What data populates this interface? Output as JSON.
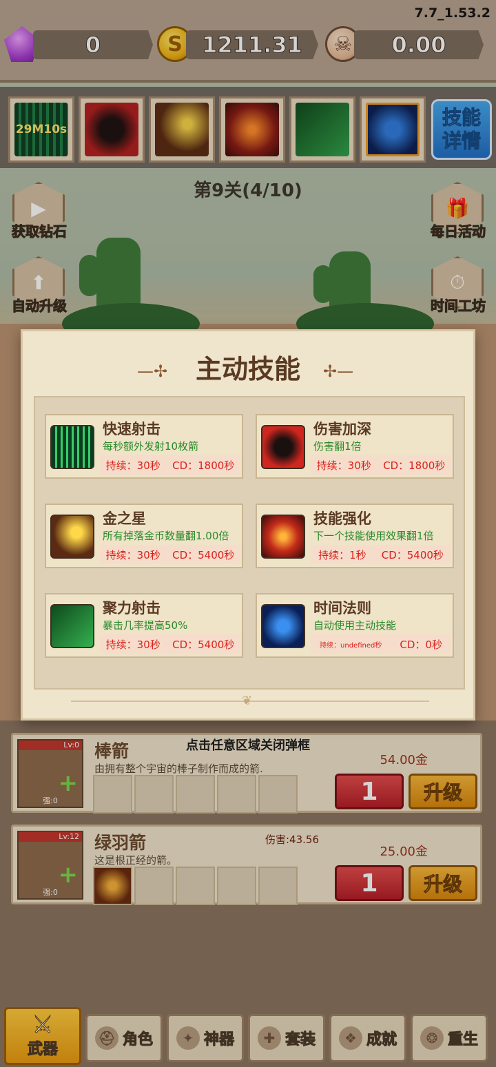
{
  "version": "7.7_1.53.2",
  "resources": {
    "gems": "0",
    "gold": "1211.31",
    "skulls": "0.00",
    "coin_symbol": "S"
  },
  "skill_bar": {
    "first_slot_timer": "29M10s",
    "detail_button": "技能详情"
  },
  "level_text": "第9关(4/10)",
  "side_buttons": {
    "get_diamonds": "获取钻石",
    "auto_upgrade": "自动升级",
    "daily_events": "每日活动",
    "time_workshop": "时间工坊"
  },
  "modal": {
    "title": "主动技能",
    "skills": [
      {
        "name": "快速射击",
        "desc": "每秒额外发射10枚箭",
        "duration": "持续：30秒",
        "cd": "CD：1800秒",
        "icon": "arrow-rain-icon"
      },
      {
        "name": "伤害加深",
        "desc": "伤害翻1倍",
        "duration": "持续：30秒",
        "cd": "CD：1800秒",
        "icon": "dark-warrior-icon"
      },
      {
        "name": "金之星",
        "desc": "所有掉落金币数量翻1.00倍",
        "duration": "持续：30秒",
        "cd": "CD：5400秒",
        "icon": "gold-stars-icon"
      },
      {
        "name": "技能强化",
        "desc": "下一个技能使用效果翻1倍",
        "duration": "持续：1秒",
        "cd": "CD：5400秒",
        "icon": "power-up-icon"
      },
      {
        "name": "聚力射击",
        "desc": "暴击几率提高50%",
        "duration": "持续：30秒",
        "cd": "CD：5400秒",
        "icon": "green-bow-icon"
      },
      {
        "name": "时间法则",
        "desc": "自动使用主动技能",
        "duration": "持续：undefined秒",
        "cd": "CD：0秒",
        "icon": "time-clock-icon"
      }
    ]
  },
  "close_hint": "点击任意区域关闭弹框",
  "weapons": [
    {
      "name": "棒箭",
      "desc": "由拥有整个宇宙的棒子制作而成的箭.",
      "lv": "Lv:0",
      "strength": "强:0",
      "price": "54.00金",
      "qty": "1",
      "upgrade": "升级",
      "damage": ""
    },
    {
      "name": "绿羽箭",
      "desc": "这是根正经的箭。",
      "lv": "Lv:12",
      "strength": "强:0",
      "price": "25.00金",
      "qty": "1",
      "upgrade": "升级",
      "damage": "伤害:43.56"
    }
  ],
  "tabs": [
    {
      "label": "武器",
      "icon": "crossed-swords-icon",
      "active": true
    },
    {
      "label": "角色",
      "icon": "helmet-icon",
      "active": false
    },
    {
      "label": "神器",
      "icon": "artifact-icon",
      "active": false
    },
    {
      "label": "套装",
      "icon": "armor-icon",
      "active": false
    },
    {
      "label": "成就",
      "icon": "achievement-icon",
      "active": false
    },
    {
      "label": "重生",
      "icon": "rebirth-icon",
      "active": false
    }
  ]
}
